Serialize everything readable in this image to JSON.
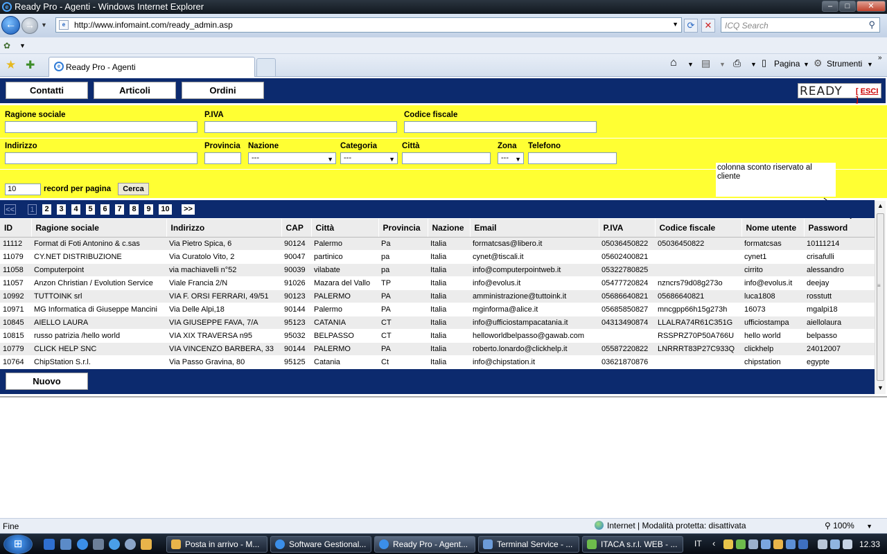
{
  "browser": {
    "window_title": "Ready Pro - Agenti - Windows Internet Explorer",
    "address": "http://www.infomaint.com/ready_admin.asp",
    "search_placeholder": "ICQ Search",
    "tab_title": "Ready Pro - Agenti",
    "toolbar_pagina": "Pagina",
    "toolbar_strumenti": "Strumenti",
    "status_left": "Fine",
    "status_zone": "Internet | Modalità protetta: disattivata",
    "zoom": "100%"
  },
  "app": {
    "nav": [
      "Contatti",
      "Articoli",
      "Ordini"
    ],
    "logo_text": "READY",
    "esci_label": "ESCI",
    "filters": {
      "ragione_sociale_label": "Ragione sociale",
      "piva_label": "P.IVA",
      "codice_fiscale_label": "Codice fiscale",
      "indirizzo_label": "Indirizzo",
      "provincia_label": "Provincia",
      "nazione_label": "Nazione",
      "nazione_value": "---",
      "categoria_label": "Categoria",
      "categoria_value": "---",
      "citta_label": "Città",
      "zona_label": "Zona",
      "zona_value": "---",
      "telefono_label": "Telefono",
      "records_value": "10",
      "records_label": "record per pagina",
      "cerca_label": "Cerca"
    },
    "note": "colonna sconto riservato al cliente",
    "pager": {
      "prev": "<<",
      "pages": [
        "1",
        "2",
        "3",
        "4",
        "5",
        "6",
        "7",
        "8",
        "9",
        "10"
      ],
      "current": "1",
      "next": ">>"
    },
    "table": {
      "headers": [
        "ID",
        "Ragione sociale",
        "Indirizzo",
        "CAP",
        "Città",
        "Provincia",
        "Nazione",
        "Email",
        "P.IVA",
        "Codice fiscale",
        "Nome utente",
        "Password"
      ],
      "rows": [
        [
          "11112",
          "Format di Foti Antonino & c.sas",
          "Via Pietro Spica, 6",
          "90124",
          "Palermo",
          "Pa",
          "Italia",
          "formatcsas@libero.it",
          "05036450822",
          "05036450822",
          "formatcsas",
          "10111214"
        ],
        [
          "11079",
          "CY.NET DISTRIBUZIONE",
          "Via Curatolo Vito, 2",
          "90047",
          "partinico",
          "pa",
          "Italia",
          "cynet@tiscali.it",
          "05602400821",
          "",
          "cynet1",
          "crisafulli"
        ],
        [
          "11058",
          "Computerpoint",
          "via machiavelli n°52",
          "90039",
          "vilabate",
          "pa",
          "Italia",
          "info@computerpointweb.it",
          "05322780825",
          "",
          "cirrito",
          "alessandro"
        ],
        [
          "11057",
          "Anzon Christian / Evolution Service",
          "Viale Francia 2/N",
          "91026",
          "Mazara del Vallo",
          "TP",
          "Italia",
          "info@evolus.it",
          "05477720824",
          "nzncrs79d08g273o",
          "info@evolus.it",
          "deejay"
        ],
        [
          "10992",
          "TUTTOINK srl",
          "VIA F. ORSI FERRARI, 49/51",
          "90123",
          "PALERMO",
          "PA",
          "Italia",
          "amministrazione@tuttoink.it",
          "05686640821",
          "05686640821",
          "luca1808",
          "rosstutt"
        ],
        [
          "10971",
          "MG Informatica di Giuseppe Mancini",
          "Via Delle Alpi,18",
          "90144",
          "Palermo",
          "PA",
          "Italia",
          "mginforma@alice.it",
          "05685850827",
          "mncgpp66h15g273h",
          "16073",
          "mgalpi18"
        ],
        [
          "10845",
          "AIELLO LAURA",
          "VIA GIUSEPPE FAVA, 7/A",
          "95123",
          "CATANIA",
          "CT",
          "Italia",
          "info@ufficiostampacatania.it",
          "04313490874",
          "LLALRA74R61C351G",
          "ufficiostampa",
          "aiellolaura"
        ],
        [
          "10815",
          "russo patrizia /hello world",
          "VIA XIX TRAVERSA n95",
          "95032",
          "BELPASSO",
          "CT",
          "Italia",
          "helloworldbelpasso@gawab.com",
          "",
          "RSSPRZ70P50A766U",
          "hello world",
          "belpasso"
        ],
        [
          "10779",
          "CLICK HELP SNC",
          "VIA VINCENZO BARBERA, 33",
          "90144",
          "PALERMO",
          "PA",
          "Italia",
          "roberto.lonardo@clickhelp.it",
          "05587220822",
          "LNRRRT83P27C933Q",
          "clickhelp",
          "24012007"
        ],
        [
          "10764",
          "ChipStation S.r.l.",
          "Via Passo Gravina, 80",
          "95125",
          "Catania",
          "Ct",
          "Italia",
          "info@chipstation.it",
          "03621870876",
          "",
          "chipstation",
          "egypte"
        ]
      ]
    },
    "nuovo_label": "Nuovo"
  },
  "taskbar": {
    "tasks": [
      "Posta in arrivo - M...",
      "Software Gestional...",
      "Ready Pro - Agent...",
      "Terminal Service - ...",
      "ITACA s.r.l. WEB - ..."
    ],
    "lang": "IT",
    "clock": "12.33"
  }
}
